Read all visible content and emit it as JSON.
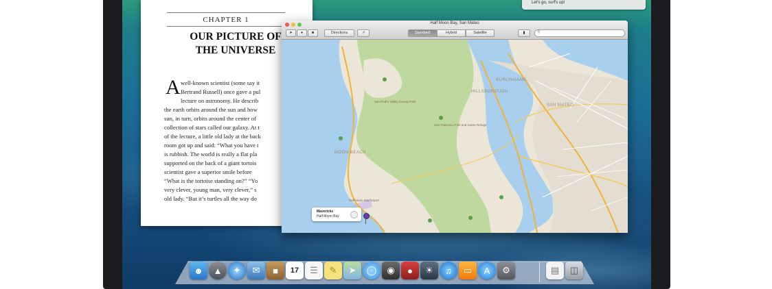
{
  "notification": {
    "text": "Let's go, surf's up!"
  },
  "book": {
    "chapter": "CHAPTER 1",
    "title_line1": "OUR PICTURE OF",
    "title_line2": "THE UNIVERSE",
    "dropcap": "A",
    "lines": [
      "well-known scientist (some say it",
      "Bertrand Russell) once gave a pul",
      "lecture on astronomy. He describ",
      "the earth orbits around the sun and how",
      "sun, in turn, orbits around the center of",
      "collection of stars called our galaxy. At t",
      "of the lecture, a little old lady at the back",
      "room got up and said: “What you have t",
      "is rubbish. The world is really a flat pla",
      "supported on the back of a giant tortois",
      "scientist gave a superior smile before",
      "“What is the tortoise standing on?” “Yo",
      "very clever, young man, very clever,” s",
      "old lady. “But it’s turtles all the way do"
    ]
  },
  "maps": {
    "title": "Half Moon Bay, San Mateo",
    "directions_label": "Directions",
    "modes": [
      "Standard",
      "Hybrid",
      "Satellite"
    ],
    "active_mode": "Standard",
    "cities": {
      "burlingame": "BURLINGAME",
      "hillsborough": "HILLSBOROUGH",
      "san_mateo": "SAN MATEO",
      "moon_beach": "MOON BEACH"
    },
    "parks": {
      "park1": "San Pedro Valley County Park",
      "park2": "San Francisco Fish and Game Refuge",
      "airport": "Half Moon Bay Airport"
    },
    "callout": {
      "name": "Mavericks",
      "place": "Half Moon Bay"
    },
    "zoom": "3D"
  },
  "dock": {
    "icons": [
      "finder-icon",
      "launchpad-icon",
      "safari-icon",
      "mail-icon",
      "contacts-icon",
      "calendar-icon",
      "reminders-icon",
      "notes-icon",
      "maps-icon",
      "messages-icon",
      "facetime-icon",
      "photo-booth-icon",
      "iphoto-icon",
      "itunes-icon",
      "ibooks-icon",
      "app-store-icon",
      "system-preferences-icon",
      "documents-stack-icon",
      "trash-icon"
    ],
    "calendar_day": "17"
  },
  "colors": {
    "water": "#a8d0ee",
    "land": "#ece6d8",
    "park": "#bfd8a0",
    "road": "#f7c95a",
    "highway": "#f0b23a"
  }
}
